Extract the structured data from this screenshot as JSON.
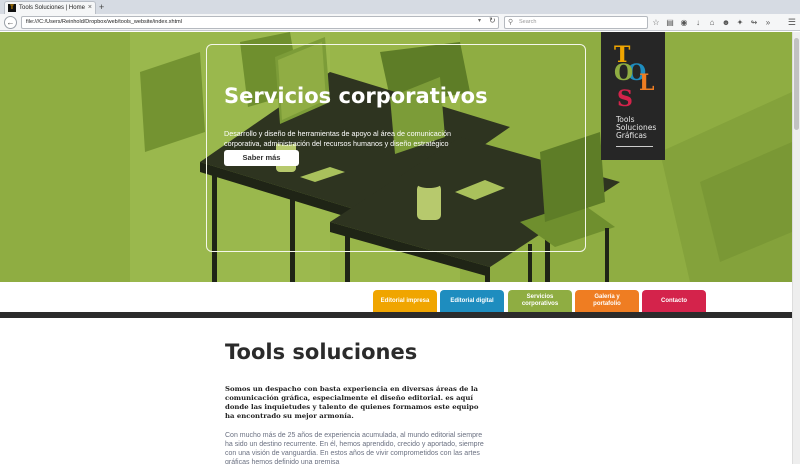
{
  "browser": {
    "tab_title": "Tools Soluciones | Home",
    "tab_close": "×",
    "new_tab": "+",
    "url": "file:///C:/Users/Reinhold/Dropbox/web/tools_website/index.xhtml",
    "search_placeholder": "Search"
  },
  "hero": {
    "title": "Servicios corporativos",
    "description": "Desarrollo y diseño de herramientas de apoyo al área de comunicación corporativa, administración del recursos humanos y diseño estratégico",
    "button": "Saber más"
  },
  "logo": {
    "letters": [
      "T",
      "O",
      "O",
      "L",
      "S"
    ],
    "letter_colors": [
      "#f0a500",
      "#1e8dbf",
      "#8fad42",
      "#ef7d22",
      "#d4234b"
    ],
    "caption_lines": [
      "Tools",
      "Soluciones",
      "Gráficas"
    ]
  },
  "nav": [
    {
      "label": "Editorial impresa",
      "color": "#f0a500"
    },
    {
      "label": "Editorial digital",
      "color": "#1e8dbf"
    },
    {
      "label": "Servicios corporativos",
      "color": "#8fad42"
    },
    {
      "label": "Galería y portafolio",
      "color": "#ef7d22"
    },
    {
      "label": "Contacto",
      "color": "#d4234b"
    }
  ],
  "content": {
    "title": "Tools soluciones",
    "intro": "Somos un despacho con basta experiencia en diversas áreas de la comunicación gráfica, especialmente el diseño editorial. es aquí donde las inquietudes y talento de quienes formamos este equipo ha encontrado su mejor armonía.",
    "body": "Con mucho más de 25 años de experiencia acumulada, al mundo editorial siempre ha sido un destino recurrente. En él, hemos aprendido, crecido y aportado, siempre con una visión de vanguardia. En estos años de vivir comprometidos con las artes gráficas hemos definido una premisa"
  }
}
